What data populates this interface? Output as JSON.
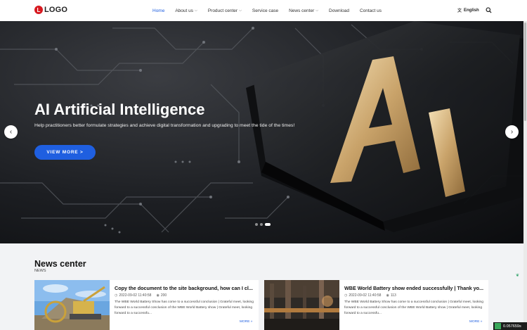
{
  "header": {
    "logo_letter": "L",
    "logo_text": "LOGO",
    "nav": [
      {
        "label": "Home",
        "active": true,
        "dropdown": false
      },
      {
        "label": "About us",
        "active": false,
        "dropdown": true
      },
      {
        "label": "Product center",
        "active": false,
        "dropdown": true
      },
      {
        "label": "Service case",
        "active": false,
        "dropdown": false
      },
      {
        "label": "News center",
        "active": false,
        "dropdown": true
      },
      {
        "label": "Download",
        "active": false,
        "dropdown": false
      },
      {
        "label": "Contact us",
        "active": false,
        "dropdown": false
      }
    ],
    "language": "English",
    "icons": {
      "language": "translate-icon",
      "search": "search-icon",
      "dropdown": "chevron-down-icon"
    }
  },
  "hero": {
    "title": "AI Artificial Intelligence",
    "subtitle": "Help practitioners better formulate strategies and achieve digital transformation and upgrading to meet the tide of the times!",
    "button": "VIEW MORE >",
    "chip_text": "AI",
    "prev_icon": "chevron-left-icon",
    "next_icon": "chevron-right-icon",
    "slides": 3,
    "active_slide": 3
  },
  "news": {
    "title": "News center",
    "subtitle": "NEWS",
    "items": [
      {
        "title": "Copy the document to the site background, how can I cl...",
        "date": "2022-09-02 11:40:58",
        "views": "200",
        "desc": "The WBE World Battery Show has come to a successful conclusion | Grateful meet, looking forward to a successful conclusion of the WBE World Battery show | Grateful meet, looking forward to a successfu...",
        "more": "MORE »",
        "image": "excavator-photo"
      },
      {
        "title": "WBE World Battery show ended successfully | Thank yo...",
        "date": "2022-09-02 11:40:58",
        "views": "113",
        "desc": "The WBE World Battery Show has come to a successful conclusion | Grateful meet, looking forward to a successful conclusion of the WBE World Battery show | Grateful meet, looking forward to a successfu...",
        "more": "MORE »",
        "image": "factory-photo"
      }
    ]
  },
  "badge": {
    "text": "0.057659s"
  },
  "colors": {
    "accent": "#1f5fe0",
    "logo": "#d71920",
    "hero_bg": "#1c1e22"
  }
}
